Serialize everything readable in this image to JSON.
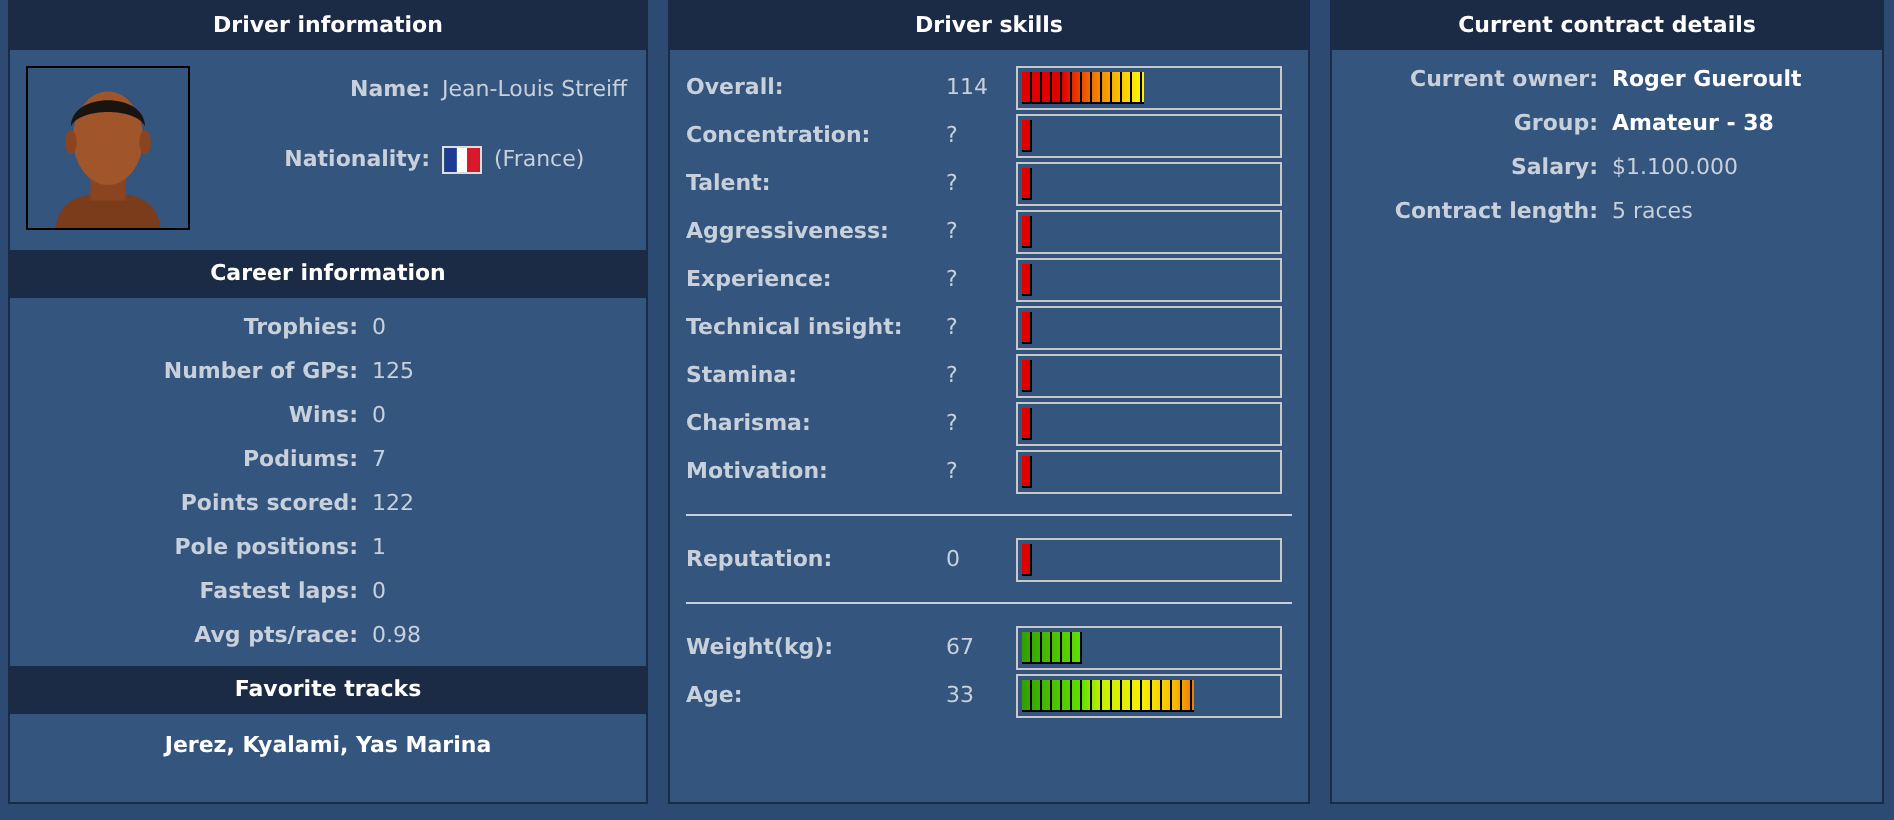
{
  "driver_info": {
    "title": "Driver information",
    "fields": [
      {
        "label": "Name:",
        "value": "Jean-Louis Streiff",
        "flag": false
      },
      {
        "label": "Nationality:",
        "value": "(France)",
        "flag": true
      }
    ]
  },
  "career": {
    "title": "Career information",
    "rows": [
      {
        "label": "Trophies:",
        "value": "0"
      },
      {
        "label": "Number of GPs:",
        "value": "125"
      },
      {
        "label": "Wins:",
        "value": "0"
      },
      {
        "label": "Podiums:",
        "value": "7"
      },
      {
        "label": "Points scored:",
        "value": "122"
      },
      {
        "label": "Pole positions:",
        "value": "1"
      },
      {
        "label": "Fastest laps:",
        "value": "0"
      },
      {
        "label": "Avg pts/race:",
        "value": "0.98"
      }
    ]
  },
  "favorite_tracks": {
    "title": "Favorite tracks",
    "text": "Jerez, Kyalami, Yas Marina"
  },
  "skills": {
    "title": "Driver skills",
    "groups": [
      [
        {
          "label": "Overall:",
          "value": "114",
          "level": 0.48,
          "kind": "skill"
        },
        {
          "label": "Concentration:",
          "value": "?",
          "level": 0.04,
          "kind": "skill"
        },
        {
          "label": "Talent:",
          "value": "?",
          "level": 0.04,
          "kind": "skill"
        },
        {
          "label": "Aggressiveness:",
          "value": "?",
          "level": 0.04,
          "kind": "skill"
        },
        {
          "label": "Experience:",
          "value": "?",
          "level": 0.04,
          "kind": "skill"
        },
        {
          "label": "Technical insight:",
          "value": "?",
          "level": 0.04,
          "kind": "skill"
        },
        {
          "label": "Stamina:",
          "value": "?",
          "level": 0.04,
          "kind": "skill"
        },
        {
          "label": "Charisma:",
          "value": "?",
          "level": 0.04,
          "kind": "skill"
        },
        {
          "label": "Motivation:",
          "value": "?",
          "level": 0.04,
          "kind": "skill"
        }
      ],
      [
        {
          "label": "Reputation:",
          "value": "0",
          "level": 0.04,
          "kind": "skill"
        }
      ],
      [
        {
          "label": "Weight(kg):",
          "value": "67",
          "level": 0.24,
          "kind": "physical"
        },
        {
          "label": "Age:",
          "value": "33",
          "level": 0.68,
          "kind": "physical"
        }
      ]
    ]
  },
  "contract": {
    "title": "Current contract details",
    "rows": [
      {
        "label": "Current owner:",
        "value": "Roger Gueroult",
        "bold": true
      },
      {
        "label": "Group:",
        "value": "Amateur - 38",
        "bold": true
      },
      {
        "label": "Salary:",
        "value": "$1.100.000",
        "bold": false
      },
      {
        "label": "Contract length:",
        "value": "5 races",
        "bold": false
      }
    ]
  }
}
